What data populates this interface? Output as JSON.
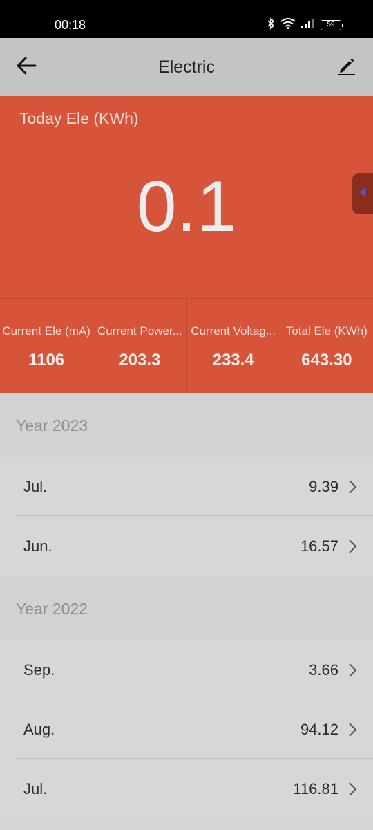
{
  "status_bar": {
    "time": "00:18",
    "battery": "59"
  },
  "app_bar": {
    "title": "Electric"
  },
  "hero": {
    "label": "Today Ele (KWh)",
    "value": "0.1"
  },
  "stats": [
    {
      "label": "Current Ele (mA)",
      "value": "1106"
    },
    {
      "label": "Current Power...",
      "value": "203.3"
    },
    {
      "label": "Current Voltag...",
      "value": "233.4"
    },
    {
      "label": "Total Ele (KWh)",
      "value": "643.30"
    }
  ],
  "years": [
    {
      "title": "Year 2023",
      "months": [
        {
          "label": "Jul.",
          "value": "9.39"
        },
        {
          "label": "Jun.",
          "value": "16.57"
        }
      ]
    },
    {
      "title": "Year 2022",
      "months": [
        {
          "label": "Sep.",
          "value": "3.66"
        },
        {
          "label": "Aug.",
          "value": "94.12"
        },
        {
          "label": "Jul.",
          "value": "116.81"
        }
      ]
    }
  ],
  "colors": {
    "accent": "#d6543a",
    "status_bar": "#000000",
    "app_bar": "#c4c4c4"
  }
}
